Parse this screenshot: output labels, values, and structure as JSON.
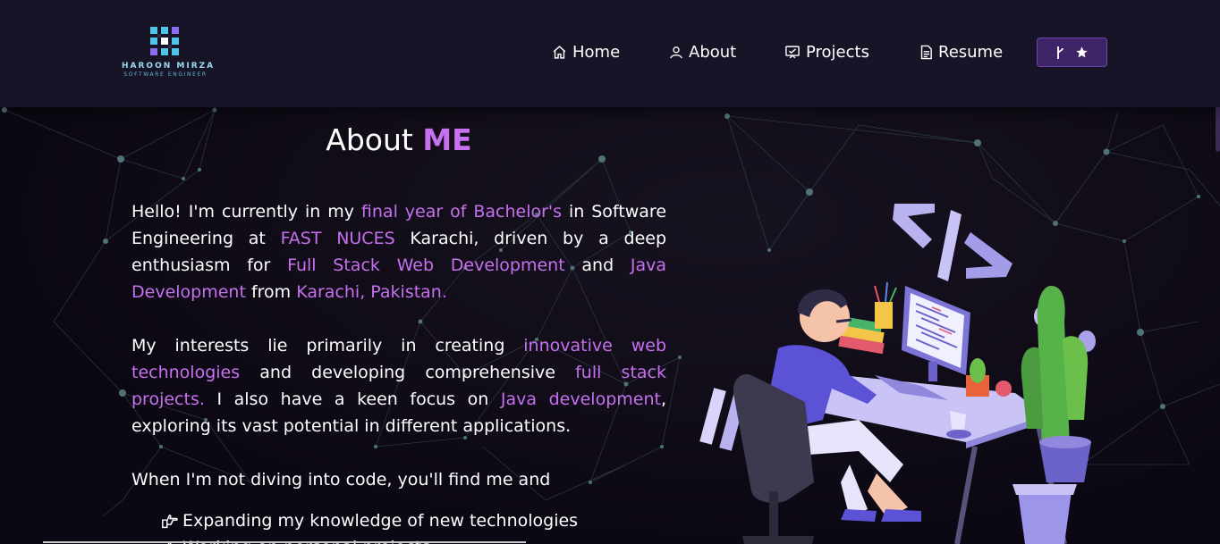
{
  "logo": {
    "name": "HAROON MIRZA",
    "subtitle": "SOFTWARE ENGINEER",
    "icon": "pixel-logo-icon"
  },
  "nav": {
    "items": [
      {
        "label": "Home",
        "icon": "home-icon"
      },
      {
        "label": "About",
        "icon": "user-icon"
      },
      {
        "label": "Projects",
        "icon": "projects-icon"
      },
      {
        "label": "Resume",
        "icon": "document-icon"
      }
    ],
    "fork_button": {
      "icons": [
        "git-fork-icon",
        "star-icon"
      ]
    }
  },
  "about": {
    "title_prefix": "About ",
    "title_accent": "ME",
    "p1": {
      "t1": "Hello! I'm currently in my ",
      "h1": "final year of Bachelor's",
      "t2": " in Software Engineering at ",
      "h2": "FAST NUCES",
      "t3": " Karachi, driven by a deep enthusiasm for ",
      "h3": "Full Stack Web Development",
      "t4": " and ",
      "h4": "Java Development",
      "t5": " from ",
      "h5": "Karachi, Pakistan."
    },
    "p2": {
      "t1": "My interests lie primarily in creating ",
      "h1": "innovative web technologies",
      "t2": " and developing comprehensive ",
      "h2": "full stack projects.",
      "t3": " I also have a keen focus on ",
      "h3": "Java development",
      "t4": ", exploring its vast potential in different applications."
    },
    "p3": "When I'm not diving into code, you'll find me and",
    "activities": [
      {
        "text": "Expanding my knowledge of new technologies",
        "icon": "pointing-hand-icon"
      },
      {
        "text": "Working on personal projects",
        "icon": "pointing-hand-icon"
      }
    ]
  },
  "colors": {
    "accent": "#c770f0",
    "navbar": "#171427",
    "background": "#0c0813",
    "button": "#3e2367"
  },
  "illustration": {
    "icon": "developer-at-desk-illustration"
  }
}
